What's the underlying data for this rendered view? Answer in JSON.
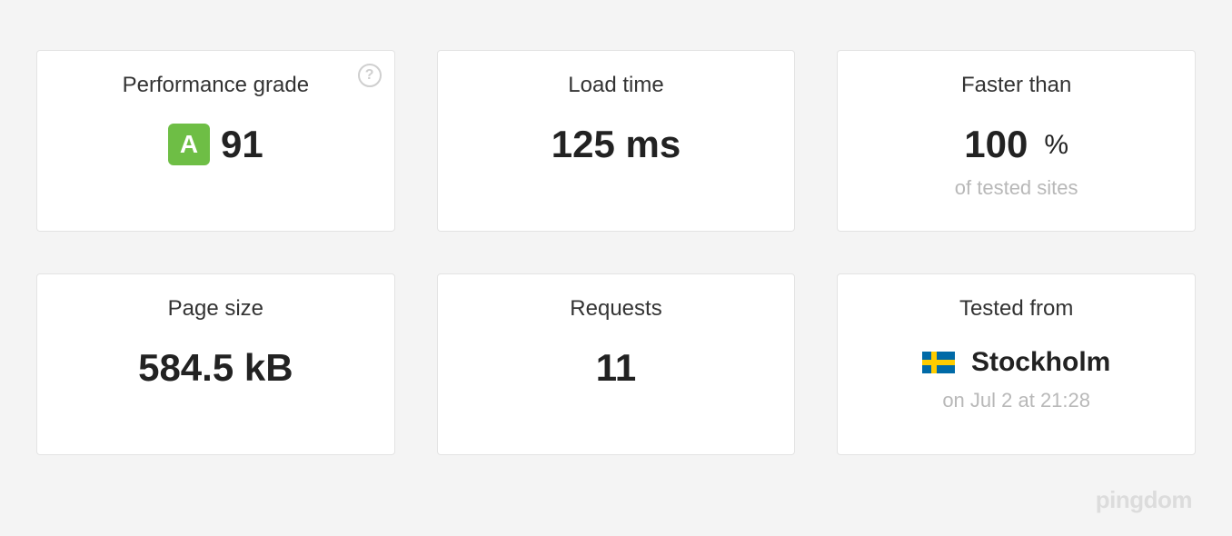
{
  "cards": {
    "performance": {
      "title": "Performance grade",
      "grade_letter": "A",
      "grade_score": "91"
    },
    "load_time": {
      "title": "Load time",
      "value": "125 ms"
    },
    "faster_than": {
      "title": "Faster than",
      "value": "100",
      "unit": "%",
      "sub": "of tested sites"
    },
    "page_size": {
      "title": "Page size",
      "value": "584.5 kB"
    },
    "requests": {
      "title": "Requests",
      "value": "11"
    },
    "tested_from": {
      "title": "Tested from",
      "location": "Stockholm",
      "sub": "on Jul 2 at 21:28"
    }
  },
  "brand": "pingdom"
}
